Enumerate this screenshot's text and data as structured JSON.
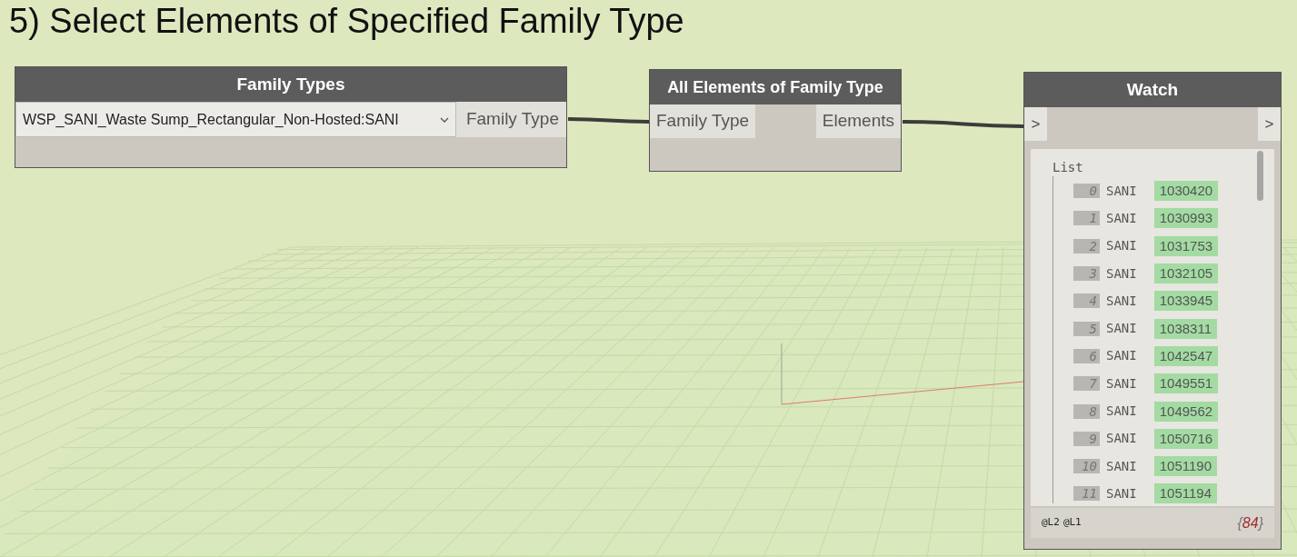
{
  "title": "5) Select Elements of Specified Family Type",
  "family_types": {
    "title": "Family Types",
    "dropdown_value": "WSP_SANI_Waste Sump_Rectangular_Non-Hosted:SANI",
    "output": "Family Type"
  },
  "all_elements": {
    "title": "All Elements of Family Type",
    "input": "Family Type",
    "output": "Elements"
  },
  "watch": {
    "title": "Watch",
    "input": ">",
    "output": ">",
    "list_label": "List",
    "items": [
      {
        "index": "0",
        "label": "SANI",
        "value": "1030420"
      },
      {
        "index": "1",
        "label": "SANI",
        "value": "1030993"
      },
      {
        "index": "2",
        "label": "SANI",
        "value": "1031753"
      },
      {
        "index": "3",
        "label": "SANI",
        "value": "1032105"
      },
      {
        "index": "4",
        "label": "SANI",
        "value": "1033945"
      },
      {
        "index": "5",
        "label": "SANI",
        "value": "1038311"
      },
      {
        "index": "6",
        "label": "SANI",
        "value": "1042547"
      },
      {
        "index": "7",
        "label": "SANI",
        "value": "1049551"
      },
      {
        "index": "8",
        "label": "SANI",
        "value": "1049562"
      },
      {
        "index": "9",
        "label": "SANI",
        "value": "1050716"
      },
      {
        "index": "10",
        "label": "SANI",
        "value": "1051190"
      },
      {
        "index": "11",
        "label": "SANI",
        "value": "1051194"
      }
    ],
    "levels": [
      "@L2",
      "@L1"
    ],
    "count_open": "{",
    "count": "84",
    "count_close": "}"
  }
}
